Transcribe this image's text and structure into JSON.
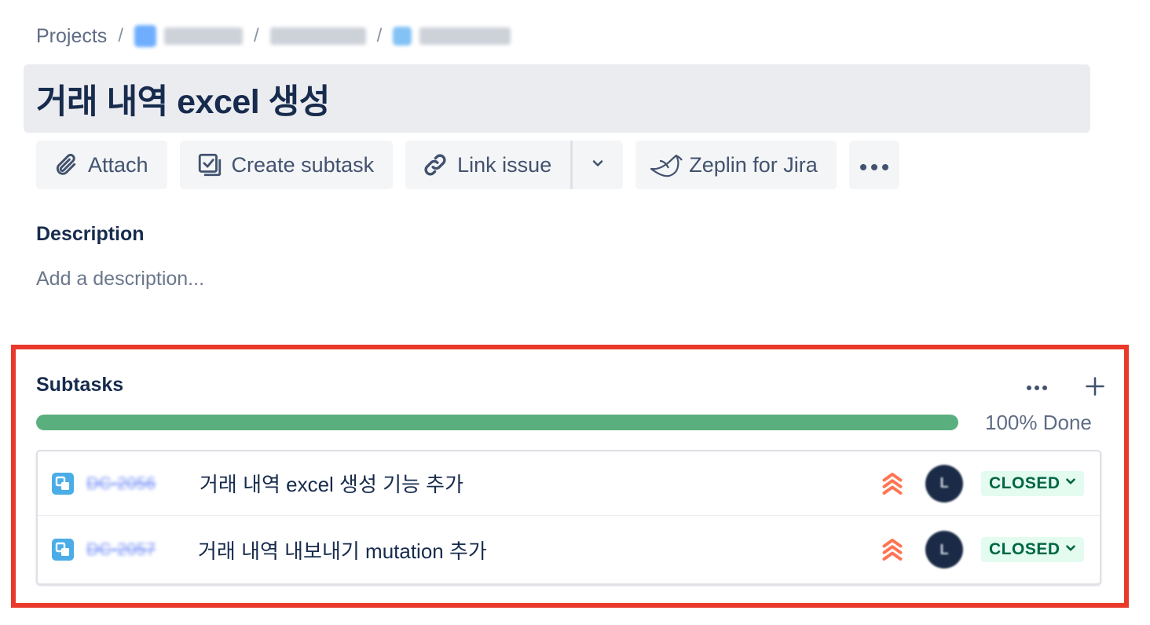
{
  "breadcrumb": {
    "projects": "Projects",
    "separator": "/"
  },
  "issue": {
    "title": "거래 내역 excel 생성"
  },
  "toolbar": {
    "attach": "Attach",
    "create_subtask": "Create subtask",
    "link_issue": "Link issue",
    "zeplin": "Zeplin for Jira"
  },
  "description": {
    "heading": "Description",
    "placeholder": "Add a description..."
  },
  "subtasks": {
    "heading": "Subtasks",
    "progress_label": "100% Done",
    "progress_fraction": 1.0,
    "progress_color": "#5aaf7e",
    "items": [
      {
        "summary": "거래 내역 excel 생성 기능 추가",
        "status": "CLOSED",
        "priority": "highest"
      },
      {
        "summary": "거래 내역 내보내기 mutation 추가",
        "status": "CLOSED",
        "priority": "highest"
      }
    ]
  },
  "colors": {
    "highlight_border": "#e8392a",
    "status_bg": "#e3fcef",
    "status_text": "#006644",
    "priority": "#ff7452"
  }
}
